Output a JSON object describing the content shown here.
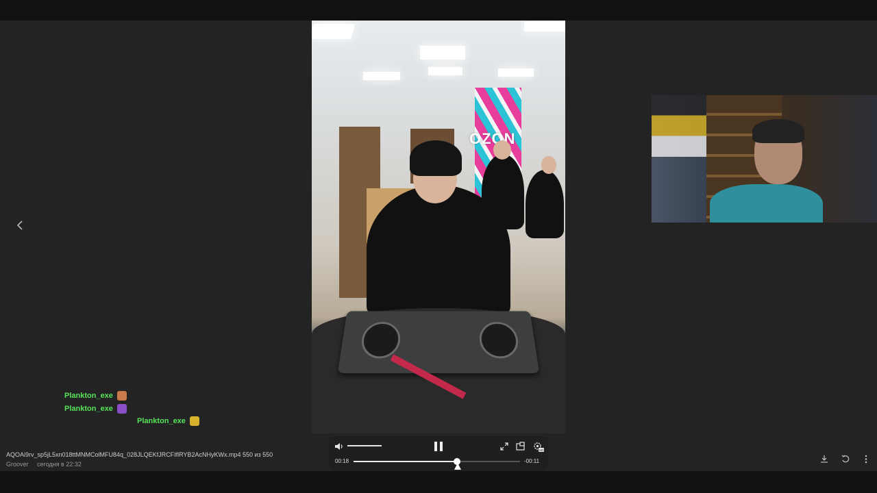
{
  "viewer": {
    "file_name": "AQOAi9rv_sp5jL5xn018ttMNMColMFU84q_028JLQEKfJRCFIflRYB2AcNHyKWx.mp4",
    "position_label": "550 из 550",
    "author": "Groover",
    "timestamp": "сегодня в 22:32"
  },
  "player": {
    "elapsed": "00:18",
    "remaining": "-00:11",
    "progress_percent": 62,
    "volume_percent": 100
  },
  "video": {
    "banner_text": "OZON"
  },
  "chat": [
    {
      "user": "Plankton_exe",
      "emote_color": "#c97a4a"
    },
    {
      "user": "Plankton_exe",
      "emote_color": "#8a4fc7"
    },
    {
      "user": "Plankton_exe",
      "emote_color": "#d6b22d"
    }
  ],
  "icons": {
    "prev": "chevron-left",
    "volume": "speaker",
    "fullscreen": "expand",
    "pip": "picture-in-picture",
    "settings": "gear-hd",
    "download": "download",
    "rotate": "rotate",
    "more": "more-vertical"
  },
  "colors": {
    "background": "#232323",
    "chat_name": "#57e35a",
    "bars": "#111111"
  }
}
